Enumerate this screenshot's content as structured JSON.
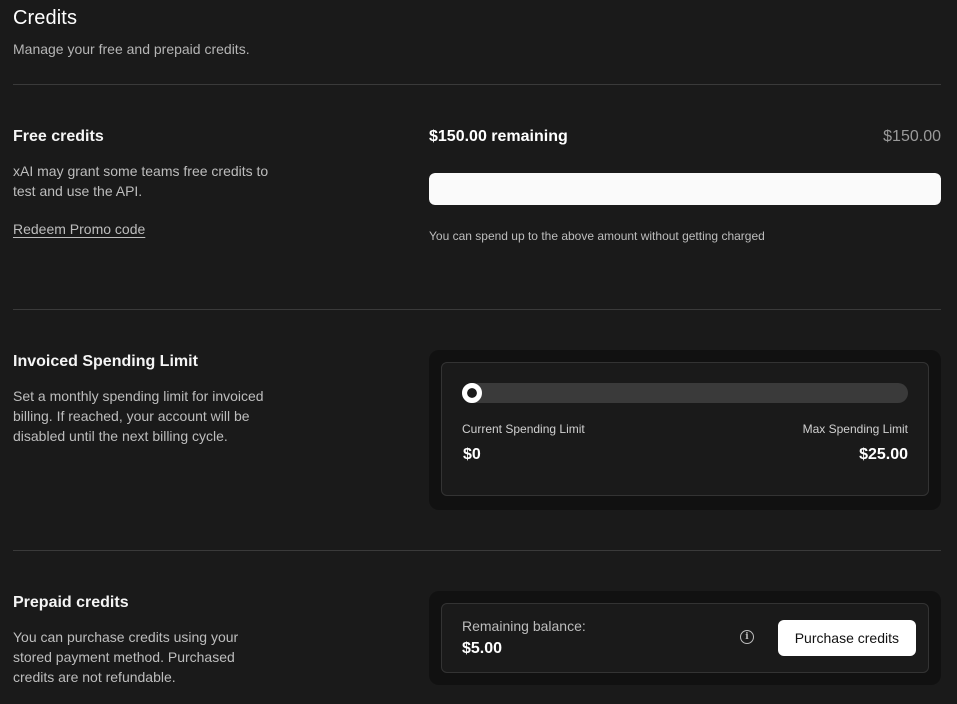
{
  "header": {
    "title": "Credits",
    "subtitle": "Manage your free and prepaid credits."
  },
  "free_credits": {
    "title": "Free credits",
    "description": "xAI may grant some teams free credits to test and use the API.",
    "promo_link": "Redeem Promo code",
    "remaining_label": "$150.00 remaining",
    "total": "$150.00",
    "remaining_fraction": 1.0,
    "note": "You can spend up to the above amount without getting charged"
  },
  "spending_limit": {
    "title": "Invoiced Spending Limit",
    "description": "Set a monthly spending limit for invoiced billing. If reached, your account will be disabled until the next billing cycle.",
    "current_label": "Current Spending Limit",
    "current_value": "$0",
    "max_label": "Max Spending Limit",
    "max_value": "$25.00",
    "slider_fraction": 0.0
  },
  "prepaid": {
    "title": "Prepaid credits",
    "description": "You can purchase credits using your stored payment method. Purchased credits are not refundable.",
    "balance_label": "Remaining balance:",
    "balance_value": "$5.00",
    "purchase_button": "Purchase credits",
    "info_icon": "info-icon"
  },
  "colors": {
    "background": "#1a1a1a",
    "card": "#111111",
    "accent": "#ffffff",
    "muted_text": "#bdbdbd"
  }
}
